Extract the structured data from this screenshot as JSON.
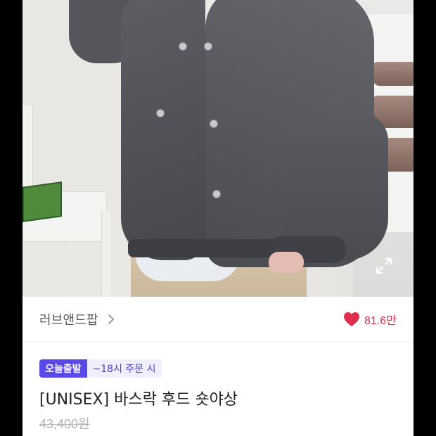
{
  "product": {
    "brand": "러브앤드팝",
    "likes": "81.6만",
    "badges": {
      "delivery": "오늘출발",
      "cutoff": "~18시 주문 시"
    },
    "title": "[UNISEX] 바스락 후드 숏야상",
    "original_price": "43,400원"
  },
  "icons": {
    "brand_chevron": "chevron-right-icon",
    "like": "heart-icon",
    "zoom": "expand-icon"
  },
  "colors": {
    "like": "#e02e4d",
    "badge_primary": "#5a48e8",
    "badge_secondary_bg": "#f0efff"
  }
}
